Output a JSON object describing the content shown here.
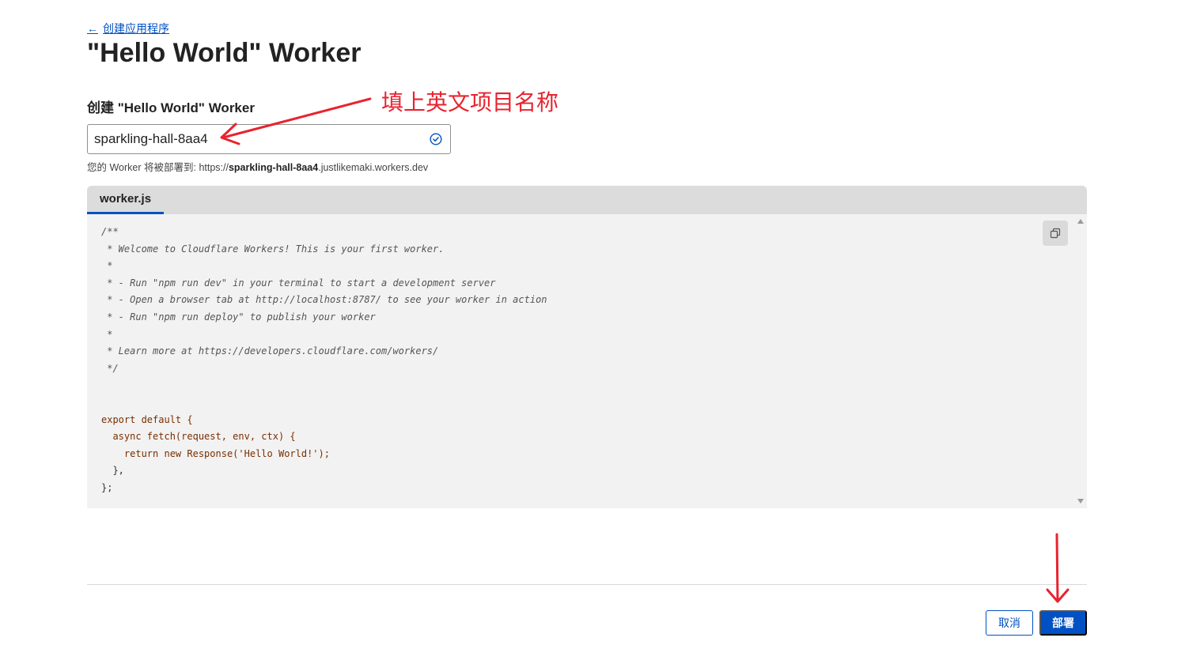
{
  "nav": {
    "back_label": "创建应用程序"
  },
  "page": {
    "title": "\"Hello World\" Worker"
  },
  "form": {
    "section_label": "创建 \"Hello World\" Worker",
    "name_value": "sparkling-hall-8aa4",
    "deploy_url_prefix": "您的 Worker 将被部署到: https://",
    "deploy_url_name": "sparkling-hall-8aa4",
    "deploy_url_suffix": ".justlikemaki.workers.dev"
  },
  "editor": {
    "tab_label": "worker.js",
    "code_lines": [
      "/**",
      " * Welcome to Cloudflare Workers! This is your first worker.",
      " *",
      " * - Run \"npm run dev\" in your terminal to start a development server",
      " * - Open a browser tab at http://localhost:8787/ to see your worker in action",
      " * - Run \"npm run deploy\" to publish your worker",
      " *",
      " * Learn more at https://developers.cloudflare.com/workers/",
      " */",
      "",
      "",
      "export default {",
      "  async fetch(request, env, ctx) {",
      "    return new Response('Hello World!');",
      "  },",
      "};"
    ]
  },
  "actions": {
    "cancel_label": "取消",
    "deploy_label": "部署"
  },
  "annotation": {
    "text": "填上英文项目名称",
    "color": "#e8232f"
  },
  "colors": {
    "accent": "#0051c3",
    "annotation": "#e8232f"
  }
}
